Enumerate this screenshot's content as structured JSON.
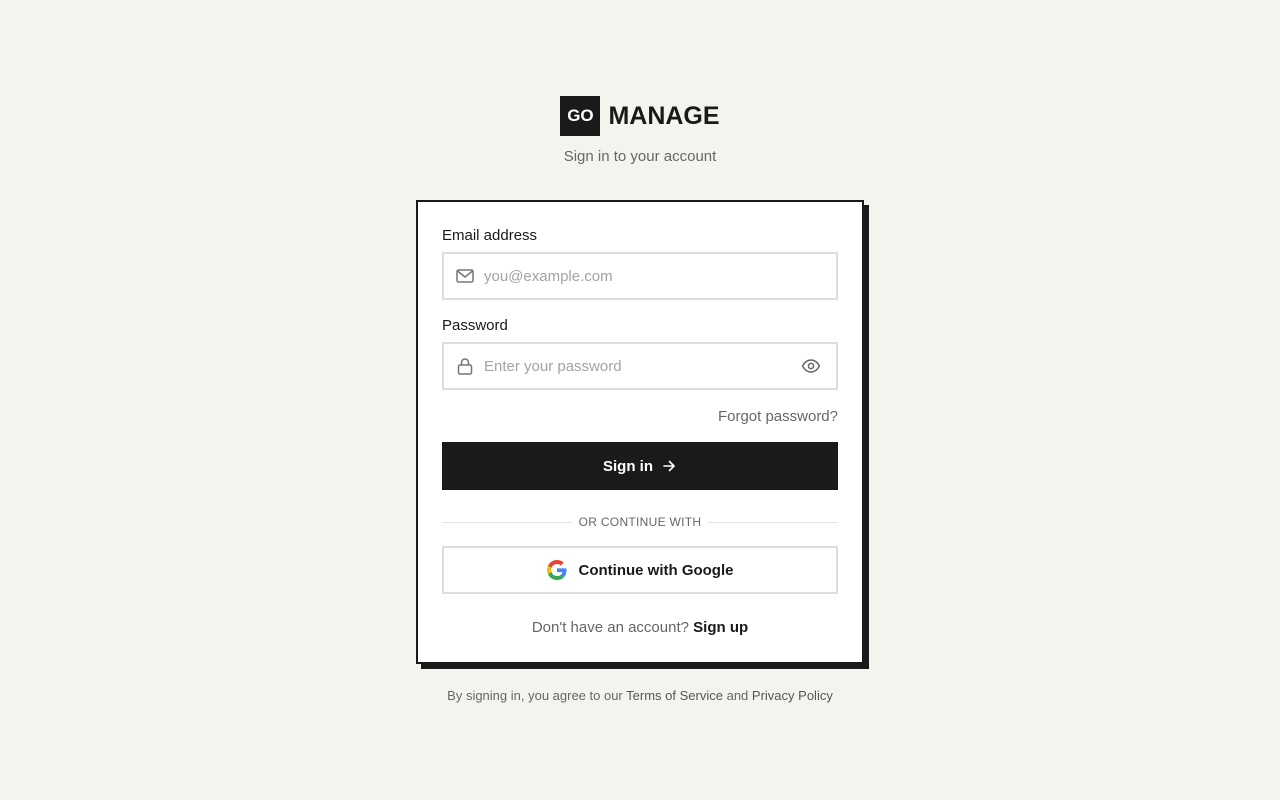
{
  "brand": {
    "mark": "GO",
    "name": "MANAGE"
  },
  "subtitle": "Sign in to your account",
  "form": {
    "email_label": "Email address",
    "email_placeholder": "you@example.com",
    "email_value": "",
    "email_icon": "mail-icon",
    "password_label": "Password",
    "password_placeholder": "Enter your password",
    "password_value": "",
    "password_icon": "lock-icon",
    "toggle_icon": "eye-icon",
    "forgot_label": "Forgot password?",
    "signin_label": "Sign in",
    "signin_icon": "arrow-right-icon",
    "divider_label": "OR CONTINUE WITH",
    "google_label": "Continue with Google",
    "google_icon": "google-icon",
    "signup_prompt": "Don't have an account?",
    "signup_link": "Sign up"
  },
  "footer": {
    "prefix": "By signing in, you agree to our",
    "terms": "Terms of Service",
    "and": "and",
    "privacy": "Privacy Policy"
  },
  "colors": {
    "background": "#f4f4ef",
    "primary": "#1a1a1a",
    "muted_text": "#666666",
    "border": "#dddddd"
  }
}
